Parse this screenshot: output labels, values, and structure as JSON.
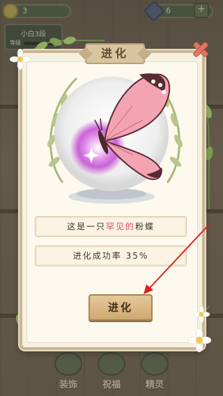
{
  "topbar": {
    "coins": "3",
    "gems": "6",
    "plus_label": "+"
  },
  "rank": {
    "title": "小白3段",
    "sub_label": "等级",
    "count": "0"
  },
  "modal": {
    "title": "进化",
    "description_prefix": "这是一只",
    "description_highlight": "罕见的",
    "description_suffix": "粉蝶",
    "success_rate_label": "进化成功率",
    "success_rate_value": "35%",
    "evolve_button": "进化"
  },
  "bottom_nav": {
    "items": [
      {
        "label": "装饰"
      },
      {
        "label": "祝福"
      },
      {
        "label": "精灵"
      }
    ]
  },
  "colors": {
    "highlight": "#e0485a",
    "annotation_arrow": "#e02020"
  }
}
